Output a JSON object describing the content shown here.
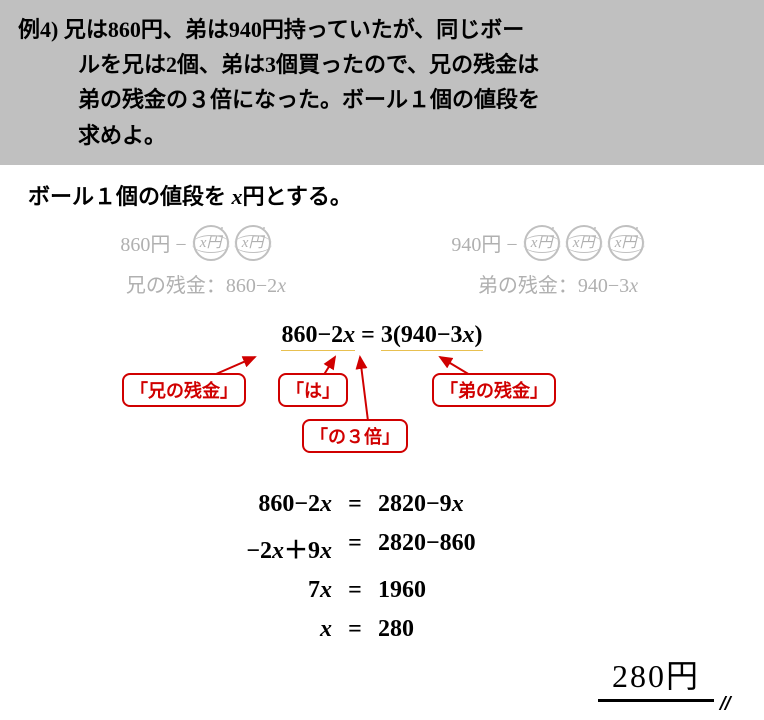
{
  "problem": {
    "label": "例4)",
    "line1": "兄は860円、弟は940円持っていたが、同じボー",
    "line2": "ルを兄は2個、弟は3個買ったので、兄の残金は",
    "line3": "弟の残金の３倍になった。ボール１個の値段を",
    "line4": "求めよ。"
  },
  "setup": {
    "prefix": "ボール１個の値段を ",
    "variable": "x",
    "suffix": "円とする。"
  },
  "diagram": {
    "elder_money": "860円 −",
    "younger_money": "940円 −",
    "ball_label": "x円",
    "elder_remainder_label": "兄の残金：",
    "elder_remainder_expr": "860−2",
    "elder_remainder_var": "x",
    "younger_remainder_label": "弟の残金：",
    "younger_remainder_expr": "940−3",
    "younger_remainder_var": "x"
  },
  "equation": {
    "lhs": "860−2",
    "lhs_var": "x",
    "eq": " = ",
    "rhs_coef": "3",
    "rhs_paren_open": "(",
    "rhs_expr": "940−3",
    "rhs_var": "x",
    "rhs_paren_close": ")"
  },
  "callouts": {
    "elder": "「兄の残金」",
    "wa": "「は」",
    "younger": "「弟の残金」",
    "triple": "「の３倍」"
  },
  "steps": [
    {
      "left_a": "860−2",
      "left_var": "x",
      "left_b": "",
      "right_a": "2820−9",
      "right_var": "x",
      "right_b": ""
    },
    {
      "left_a": "−2",
      "left_var": "x",
      "left_b": "＋9",
      "left_var2": "x",
      "right_a": "2820−860",
      "right_var": "",
      "right_b": ""
    },
    {
      "left_a": "7",
      "left_var": "x",
      "left_b": "",
      "right_a": "1960",
      "right_var": "",
      "right_b": ""
    },
    {
      "left_a": "",
      "left_var": "x",
      "left_b": "",
      "right_a": "280",
      "right_var": "",
      "right_b": ""
    }
  ],
  "eq_sign": "=",
  "answer": "280円"
}
